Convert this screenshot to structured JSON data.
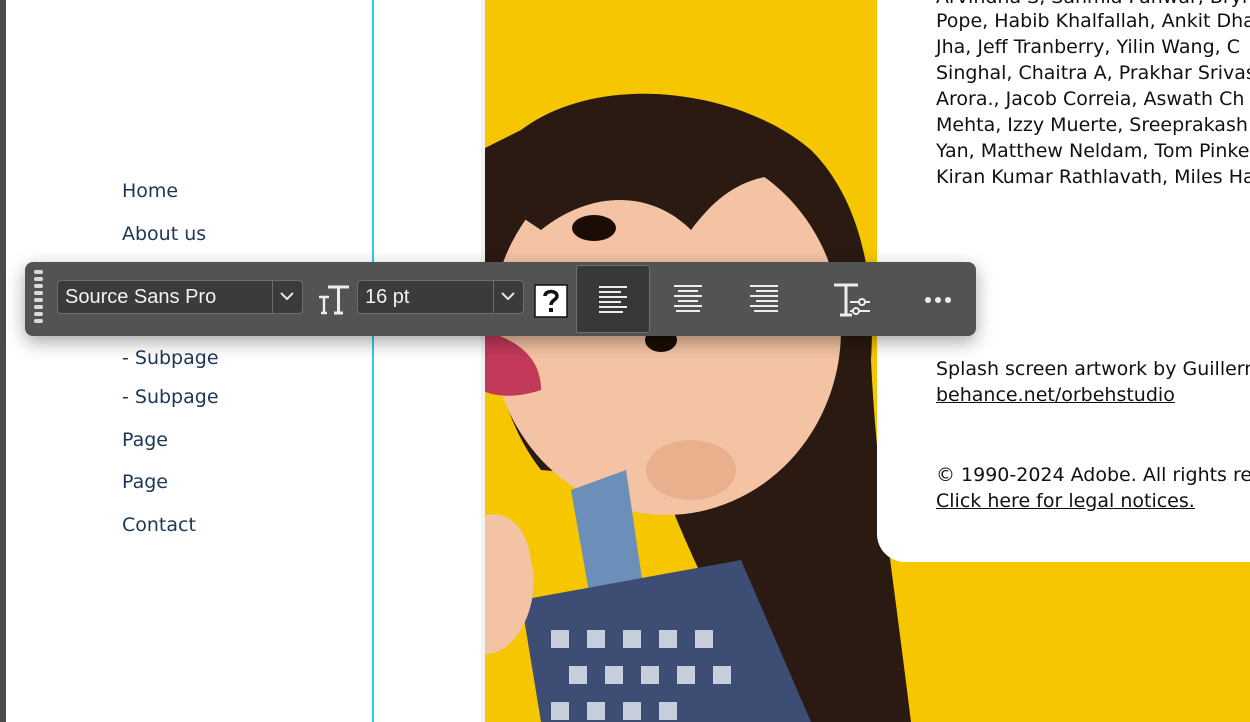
{
  "nav": {
    "items": [
      "Home",
      "About us",
      "- Subpage",
      "- Subpage",
      "Page",
      "Page",
      "Contact"
    ]
  },
  "credits": {
    "lines": [
      "Arvindha S, Sanmla Panwar, Bryn",
      "Pope, Habib Khalfallah, Ankit Dha",
      "Jha, Jeff Tranberry, Yilin Wang, C",
      "Singhal, Chaitra A, Prakhar Srivas",
      "Arora., Jacob Correia, Aswath Ch",
      "Mehta, Izzy Muerte, Sreeprakash",
      "Yan, Matthew Neldam, Tom Pinke",
      "Kiran Kumar Rathlavath, Miles Ha"
    ],
    "splash": "Splash screen artwork by Guillerm",
    "behance": "behance.net/orbehstudio",
    "copyright": "© 1990-2024 Adobe. All rights re",
    "legal": "Click here for legal notices."
  },
  "toolbar": {
    "font_family": "Source Sans Pro",
    "font_size": "16 pt",
    "buttons": [
      "font-family-dropdown",
      "font-size-dropdown",
      "missing-glyph",
      "align-left",
      "align-center",
      "align-right",
      "text-options",
      "more-options"
    ],
    "selected_alignment": "align-left"
  },
  "colors": {
    "toolbar_bg": "#535353",
    "photo_bg": "#f6c700",
    "nav_text": "#1d3557",
    "guide": "#33c9ee"
  }
}
